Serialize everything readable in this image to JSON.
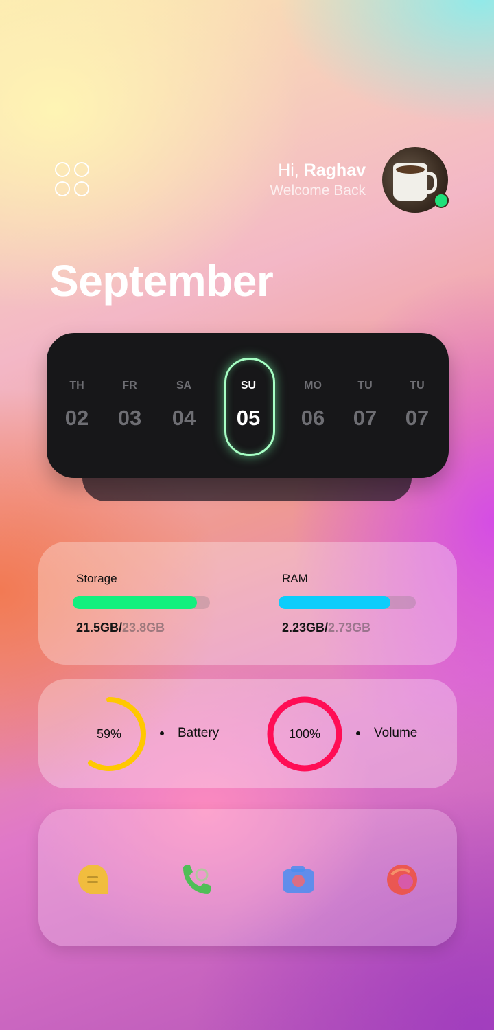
{
  "header": {
    "greeting_prefix": "Hi, ",
    "user_name": "Raghav",
    "welcome": "Welcome Back"
  },
  "month": "September",
  "calendar": {
    "days": [
      {
        "name": "TH",
        "date": "02"
      },
      {
        "name": "FR",
        "date": "03"
      },
      {
        "name": "SA",
        "date": "04"
      },
      {
        "name": "SU",
        "date": "05",
        "selected": true
      },
      {
        "name": "MO",
        "date": "06"
      },
      {
        "name": "TU",
        "date": "07"
      },
      {
        "name": "TU",
        "date": "07"
      }
    ],
    "highlight_color": "#a6ffc4"
  },
  "storage": {
    "label": "Storage",
    "used": "21.5GB/",
    "total": "23.8GB",
    "fraction": 0.903,
    "color": "#12f07e"
  },
  "ram": {
    "label": "RAM",
    "used": "2.23GB/",
    "total": "2.73GB",
    "fraction": 0.817,
    "color": "#0dcdfb"
  },
  "battery": {
    "value": "59%",
    "label": "Battery",
    "percent": 59,
    "color": "#ffc800"
  },
  "volume": {
    "value": "100%",
    "label": "Volume",
    "percent": 100,
    "color": "#ff0d55"
  },
  "dock": {
    "apps": [
      {
        "icon": "messages-icon",
        "color": "#f2c12e"
      },
      {
        "icon": "phone-icon",
        "color": "#3ec24a"
      },
      {
        "icon": "camera-icon",
        "color": "#4a8df0"
      },
      {
        "icon": "browser-icon",
        "color": "#f0503c"
      }
    ]
  }
}
